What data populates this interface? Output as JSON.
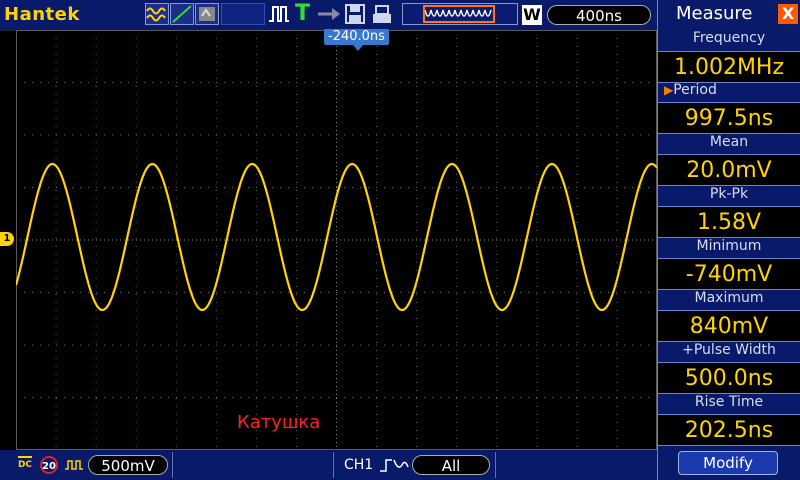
{
  "topbar": {
    "brand": "Hantek",
    "trigger_letter": "T",
    "memory_badge": "W",
    "timebase": "400ns"
  },
  "display": {
    "trigger_position": "-240.0ns",
    "channel_marker": "1",
    "label": "Катушка",
    "trace_color": "#ffd400"
  },
  "bottombar": {
    "coupling": "DC",
    "bw_limit": "20",
    "volts_div": "500mV",
    "trigger_source": "CH1",
    "trigger_mode": "All"
  },
  "measure": {
    "title": "Measure",
    "close_label": "X",
    "items": [
      {
        "label": "Frequency",
        "value": "1.002MHz"
      },
      {
        "label": "Period",
        "value": "997.5ns"
      },
      {
        "label": "Mean",
        "value": "20.0mV"
      },
      {
        "label": "Pk-Pk",
        "value": "1.58V"
      },
      {
        "label": "Minimum",
        "value": "-740mV"
      },
      {
        "label": "Maximum",
        "value": "840mV"
      },
      {
        "label": "+Pulse Width",
        "value": "500.0ns"
      },
      {
        "label": "Rise Time",
        "value": "202.5ns"
      }
    ],
    "modify_label": "Modify"
  }
}
